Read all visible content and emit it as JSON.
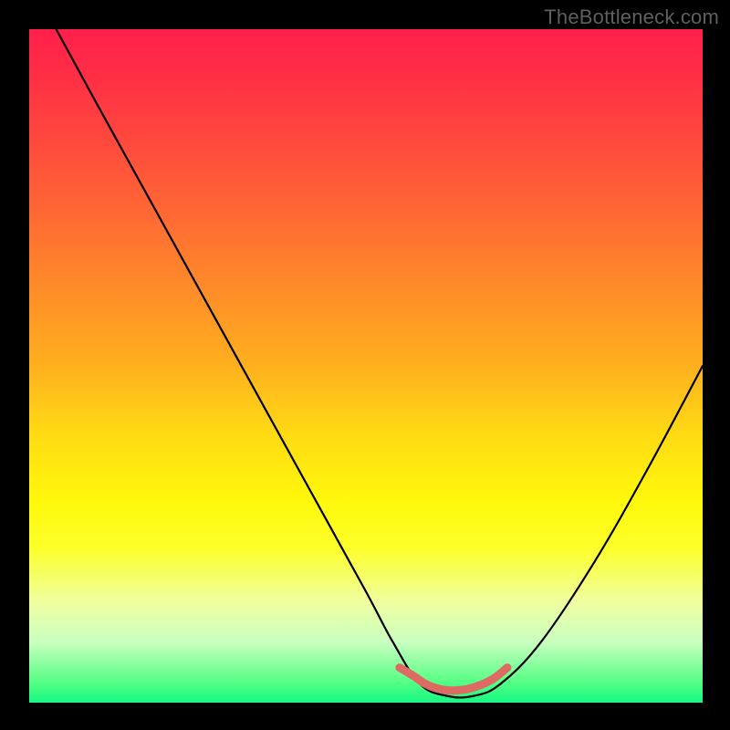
{
  "watermark": "TheBottleneck.com",
  "chart_data": {
    "type": "line",
    "title": "",
    "xlabel": "",
    "ylabel": "",
    "xlim": [
      0,
      100
    ],
    "ylim": [
      0,
      100
    ],
    "grid": false,
    "series": [
      {
        "name": "bottleneck-curve",
        "x": [
          4,
          10,
          18,
          26,
          34,
          42,
          50,
          54,
          58,
          62,
          66,
          70,
          76,
          84,
          92,
          100
        ],
        "y": [
          100,
          89,
          74.5,
          60,
          45.5,
          31,
          16.5,
          9,
          2.8,
          1,
          1,
          2.8,
          9,
          21,
          35,
          50
        ]
      },
      {
        "name": "optimal-marker",
        "x": [
          55,
          57,
          59,
          61,
          63,
          65,
          67,
          69,
          71
        ],
        "y": [
          5.2,
          4.0,
          2.7,
          2.0,
          1.8,
          2.0,
          2.6,
          3.6,
          5.2
        ]
      }
    ]
  },
  "colors": {
    "background": "#000000",
    "curve": "#000000",
    "marker": "#dd6b63",
    "gradient_top": "#ff1f4b",
    "gradient_bottom": "#14f882"
  }
}
